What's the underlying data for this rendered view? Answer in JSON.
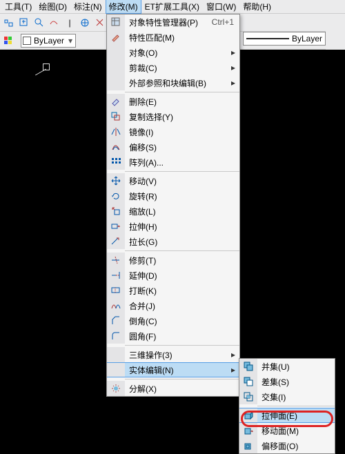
{
  "menubar": {
    "items": [
      "工具(T)",
      "绘图(D)",
      "标注(N)",
      "修改(M)",
      "ET扩展工具(X)",
      "窗口(W)",
      "帮助(H)"
    ]
  },
  "proprow": {
    "layer_sel": "ByLayer",
    "linetype_label": "ByLayer"
  },
  "modify": {
    "props_mgr": "对象特性管理器(P)",
    "props_mgr_key": "Ctrl+1",
    "match": "特性匹配(M)",
    "object": "对象(O)",
    "clip": "剪裁(C)",
    "xrefedit": "外部参照和块编辑(B)",
    "erase": "删除(E)",
    "copy": "复制选择(Y)",
    "mirror": "镜像(I)",
    "offset": "偏移(S)",
    "array": "阵列(A)...",
    "move": "移动(V)",
    "rotate": "旋转(R)",
    "scale": "缩放(L)",
    "stretch": "拉伸(H)",
    "lengthen": "拉长(G)",
    "trim": "修剪(T)",
    "extend": "延伸(D)",
    "break": "打断(K)",
    "join": "合并(J)",
    "chamfer": "倒角(C)",
    "fillet": "圆角(F)",
    "threed": "三维操作(3)",
    "solidedit": "实体编辑(N)",
    "explode": "分解(X)"
  },
  "submenu": {
    "union": "并集(U)",
    "subtract": "差集(S)",
    "intersect": "交集(I)",
    "extrudeface": "拉伸面(E)",
    "moveface": "移动面(M)",
    "offsetface": "偏移面(O)"
  }
}
